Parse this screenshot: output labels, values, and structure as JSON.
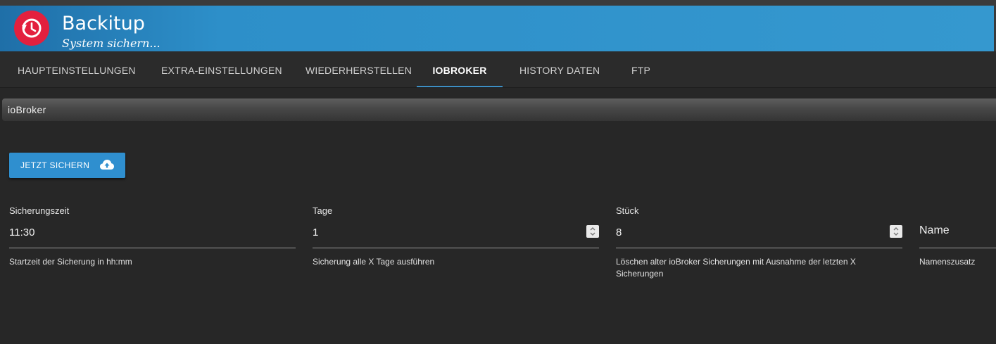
{
  "app": {
    "title": "Backitup",
    "subtitle": "System sichern..."
  },
  "tabs": [
    {
      "label": "HAUPTEINSTELLUNGEN",
      "active": false
    },
    {
      "label": "EXTRA-EINSTELLUNGEN",
      "active": false
    },
    {
      "label": "WIEDERHERSTELLEN",
      "active": false
    },
    {
      "label": "IOBROKER",
      "active": true
    },
    {
      "label": "HISTORY DATEN",
      "active": false
    },
    {
      "label": "FTP",
      "active": false
    }
  ],
  "section": {
    "title": "ioBroker"
  },
  "backup_button": {
    "label": "JETZT SICHERN",
    "icon": "cloud-upload-icon"
  },
  "fields": {
    "time": {
      "label": "Sicherungszeit",
      "value": "11:30",
      "help": "Startzeit der Sicherung in hh:mm"
    },
    "days": {
      "label": "Tage",
      "value": "1",
      "help": "Sicherung alle X Tage ausführen"
    },
    "count": {
      "label": "Stück",
      "value": "8",
      "help": "Löschen alter ioBroker Sicherungen mit Ausnahme der letzten X Sicherungen"
    },
    "name": {
      "label": "Name",
      "help": "Namenszusatz"
    }
  },
  "colors": {
    "header_blue": "#3598cf",
    "accent": "#2f8fcf",
    "logo_red": "#e3203e",
    "background": "#272727"
  }
}
